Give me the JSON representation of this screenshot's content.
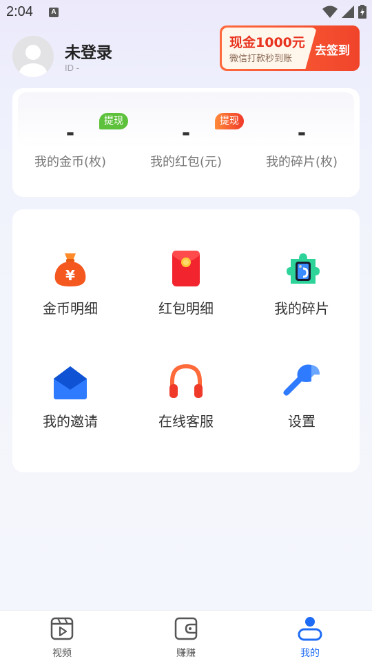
{
  "status_bar": {
    "time": "2:04",
    "notification_icon": "A"
  },
  "profile": {
    "username": "未登录",
    "id_text": "ID  -"
  },
  "banner": {
    "title": "现金1000元",
    "subtitle": "微信打款秒到账",
    "button": "去签到"
  },
  "wallet": {
    "stats": [
      {
        "value": "-",
        "label": "我的金币(枚)",
        "badge": "提现"
      },
      {
        "value": "-",
        "label": "我的红包(元)",
        "badge": "提现"
      },
      {
        "value": "-",
        "label": "我的碎片(枚)"
      }
    ]
  },
  "menu": {
    "items": [
      {
        "label": "金币明细",
        "icon": "money-bag-icon"
      },
      {
        "label": "红包明细",
        "icon": "red-envelope-icon"
      },
      {
        "label": "我的碎片",
        "icon": "puzzle-phone-icon"
      },
      {
        "label": "我的邀请",
        "icon": "envelope-icon"
      },
      {
        "label": "在线客服",
        "icon": "headphones-icon"
      },
      {
        "label": "设置",
        "icon": "wrench-icon"
      }
    ]
  },
  "bottom_nav": {
    "items": [
      {
        "label": "视频",
        "icon": "video-icon"
      },
      {
        "label": "赚赚",
        "icon": "wallet-icon"
      },
      {
        "label": "我的",
        "icon": "user-icon",
        "active": true
      }
    ]
  },
  "colors": {
    "accent": "#1e6bf5",
    "banner_red": "#f0442a",
    "badge_green": "#5ec13b"
  }
}
